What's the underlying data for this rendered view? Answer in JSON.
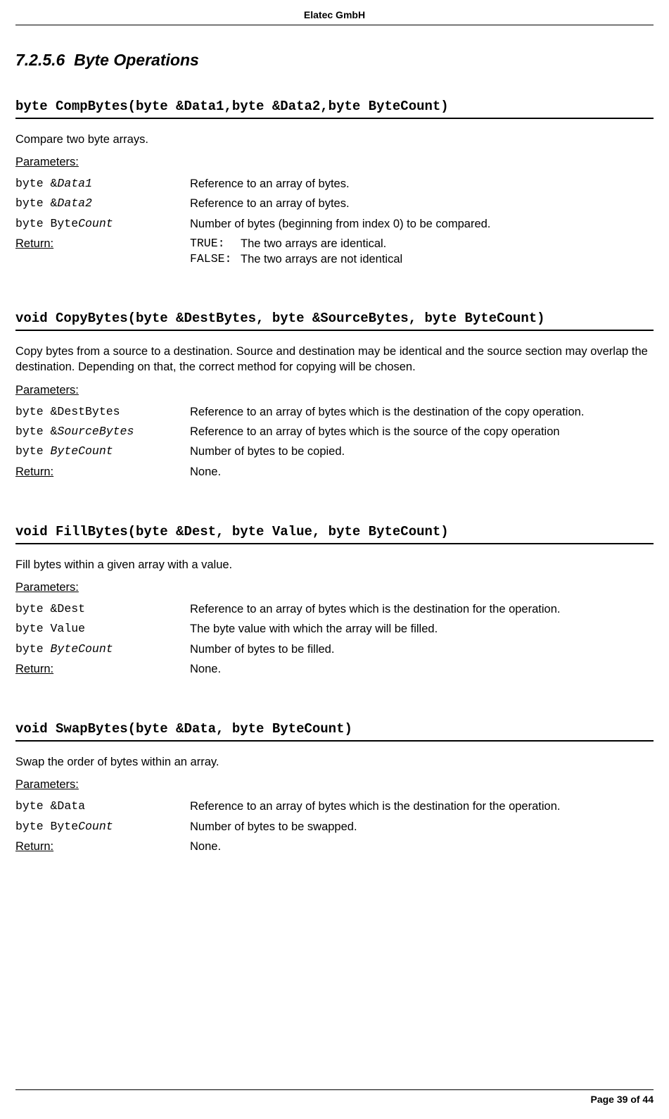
{
  "header": {
    "company": "Elatec GmbH"
  },
  "section": {
    "number": "7.2.5.6",
    "title": "Byte Operations"
  },
  "functions": [
    {
      "signature": "byte CompBytes(byte &Data1,byte &Data2,byte ByteCount)",
      "description": "Compare two byte arrays.",
      "params_label": "Parameters:",
      "params": [
        {
          "prefix": "byte &",
          "name": "Data1",
          "italic": true,
          "desc": "Reference to an array of bytes."
        },
        {
          "prefix": "byte &",
          "name": "Data2",
          "italic": true,
          "desc": "Reference to an array of bytes."
        },
        {
          "prefix": "byte Byte",
          "name": "Count",
          "italic": true,
          "desc": "Number of bytes (beginning from index 0) to be compared."
        }
      ],
      "return_label": "Return:",
      "return_rows": [
        {
          "code": "TRUE",
          "sep": ":",
          "text": "The two arrays are identical."
        },
        {
          "code": "FALSE",
          "sep": ":",
          "text": "The two arrays are not identical"
        }
      ]
    },
    {
      "signature": "void CopyBytes(byte &DestBytes, byte &SourceBytes, byte ByteCount)",
      "description": "Copy bytes from a source to a destination. Source and destination may be identical and the source section may overlap the destination. Depending on that, the correct method for copying will be chosen.",
      "params_label": "Parameters:",
      "params": [
        {
          "prefix": "byte &",
          "name": "DestBytes",
          "italic": false,
          "desc": "Reference to an array of bytes which is the destination of the copy operation."
        },
        {
          "prefix": "byte &",
          "name": "SourceBytes",
          "italic": true,
          "desc": "Reference to an array of bytes which is the source of the copy operation"
        },
        {
          "prefix": "byte ",
          "name": "ByteCount",
          "italic": true,
          "desc": "Number of bytes to be copied."
        }
      ],
      "return_label": "Return:",
      "return_simple": "None."
    },
    {
      "signature": "void FillBytes(byte &Dest, byte Value, byte ByteCount)",
      "description": "Fill bytes within a given array with a value.",
      "params_label": "Parameters:",
      "params": [
        {
          "prefix": "byte &",
          "name": "Dest",
          "italic": false,
          "desc": "Reference to an array of bytes which is the destination for the operation."
        },
        {
          "prefix": "byte ",
          "name": "Value",
          "italic": false,
          "desc": "The byte value with which the array will be filled."
        },
        {
          "prefix": "byte ",
          "name": "ByteCount",
          "italic": true,
          "desc": "Number of bytes to be filled."
        }
      ],
      "return_label": "Return:",
      "return_simple": "None."
    },
    {
      "signature": "void SwapBytes(byte &Data, byte ByteCount)",
      "description": "Swap the order of bytes within an array.",
      "params_label": "Parameters:",
      "params": [
        {
          "prefix": "byte &",
          "name": "Data",
          "italic": false,
          "desc": "Reference to an array of bytes which is the destination for the operation."
        },
        {
          "prefix": "byte Byte",
          "name": "Count",
          "italic": true,
          "desc": "Number of bytes to be swapped."
        }
      ],
      "return_label": "Return:",
      "return_simple": "None."
    }
  ],
  "footer": {
    "page_label": "Page 39 of 44"
  }
}
